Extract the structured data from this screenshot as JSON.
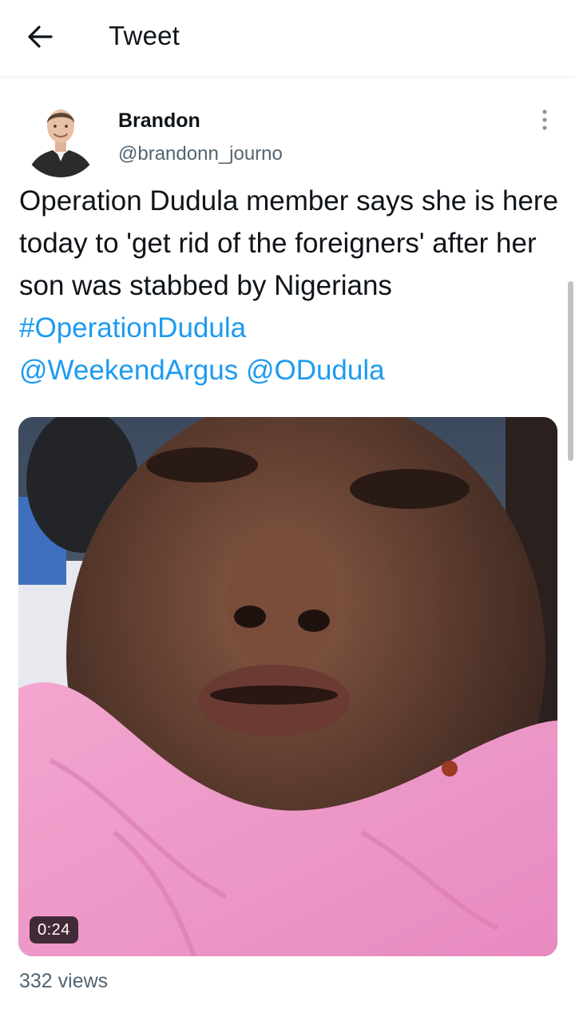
{
  "header": {
    "title": "Tweet",
    "back_icon": "arrow-left-icon"
  },
  "tweet": {
    "author": {
      "display_name": "Brandon",
      "handle": "@brandonn_journo",
      "more_icon": "more-vertical-icon"
    },
    "text_plain_1": "Operation Dudula member says she is here today to 'get rid of the foreigners' after her son was stabbed by Nigerians ",
    "hashtag": "#OperationDudula",
    "mention_1": "@WeekendArgus",
    "text_space": " ",
    "mention_2": "@ODudula",
    "media": {
      "type": "video",
      "duration": "0:24"
    },
    "views": "332 views"
  },
  "colors": {
    "link": "#1d9bf0",
    "text": "#0f1419",
    "secondary": "#536471"
  }
}
